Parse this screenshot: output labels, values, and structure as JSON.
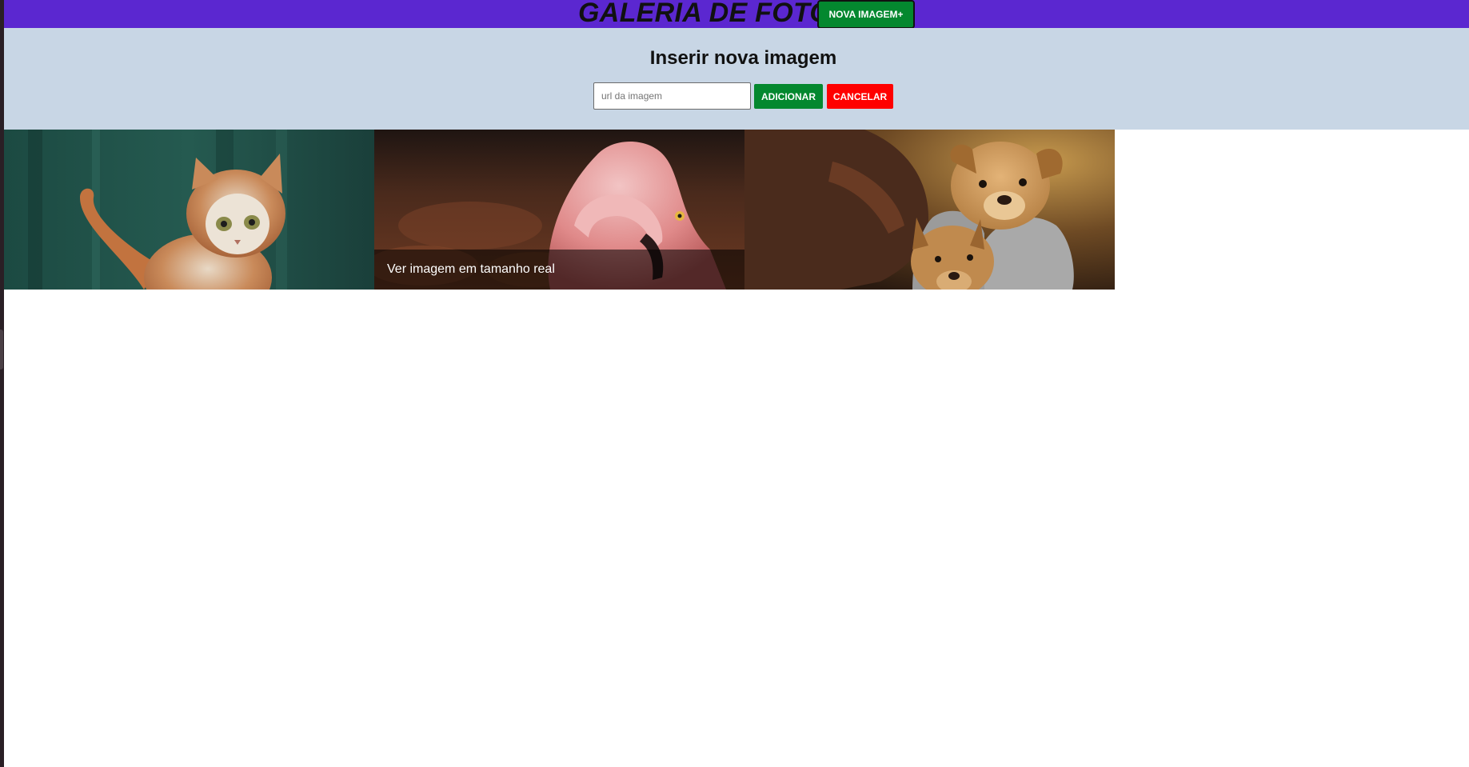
{
  "header": {
    "title": "GALERIA DE FOTOS",
    "new_image_button": "NOVA IMAGEM+"
  },
  "insert_panel": {
    "title": "Inserir nova imagem",
    "url_input": {
      "placeholder": "url da imagem",
      "value": ""
    },
    "add_button": "ADICIONAR",
    "cancel_button": "CANCELAR"
  },
  "gallery": {
    "photos": [
      {
        "subject": "cat",
        "overlay_visible": false
      },
      {
        "subject": "flamingo",
        "overlay_visible": true,
        "overlay_text": "Ver imagem em tamanho real"
      },
      {
        "subject": "puppies",
        "overlay_visible": false
      }
    ]
  },
  "colors": {
    "header_bg": "#5b27d0",
    "panel_bg": "#c8d6e5",
    "add_green": "#04882f",
    "cancel_red": "#ff0000"
  }
}
